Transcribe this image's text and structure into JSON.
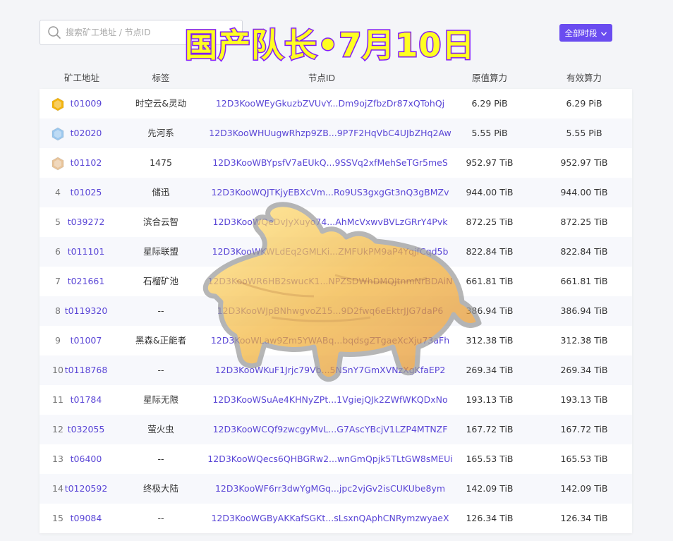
{
  "search": {
    "placeholder": "搜索矿工地址 / 节点ID"
  },
  "banner": {
    "text": "国产队长•7月10日"
  },
  "period_select": {
    "label": "全部时段"
  },
  "columns": {
    "miner": "矿工地址",
    "tag": "标签",
    "node": "节点ID",
    "raw_power": "原值算力",
    "effective_power": "有效算力"
  },
  "rows": [
    {
      "rank": "",
      "medal": "gold-medal-icon",
      "miner": "t01009",
      "tag": "时空云&灵动",
      "node": "12D3KooWEyGkuzbZVUvY...Dm9ojZfbzDr87xQTohQj",
      "raw": "6.29 PiB",
      "eff": "6.29 PiB"
    },
    {
      "rank": "",
      "medal": "silver-medal-icon",
      "miner": "t02020",
      "tag": "先河系",
      "node": "12D3KooWHUugwRhzp9ZB...9P7F2HqVbC4UJbZHq2Aw",
      "raw": "5.55 PiB",
      "eff": "5.55 PiB"
    },
    {
      "rank": "",
      "medal": "bronze-medal-icon",
      "miner": "t01102",
      "tag": "1475",
      "node": "12D3KooWBYpsfV7aEUkQ...9SSVq2xfMehSeTGr5meS",
      "raw": "952.97 TiB",
      "eff": "952.97 TiB"
    },
    {
      "rank": "4",
      "medal": "",
      "miner": "t01025",
      "tag": "储迅",
      "node": "12D3KooWQJTKjyEBXcVm...Ro9US3gxgGt3nQ3gBMZv",
      "raw": "944.00 TiB",
      "eff": "944.00 TiB"
    },
    {
      "rank": "5",
      "medal": "",
      "miner": "t039272",
      "tag": "滨合云智",
      "node": "12D3KooWQeDvJyXuyo74...AhMcVxwvBVLzGRrY4Pvk",
      "raw": "872.25 TiB",
      "eff": "872.25 TiB"
    },
    {
      "rank": "6",
      "medal": "",
      "miner": "t011101",
      "tag": "星际联盟",
      "node": "12D3KooWKWLdEq2GMLKi...ZMFUkPM9aP4YqjfCqd5b",
      "raw": "822.84 TiB",
      "eff": "822.84 TiB"
    },
    {
      "rank": "7",
      "medal": "",
      "miner": "t021661",
      "tag": "石榴矿池",
      "node": "12D3KooWR6HB2swucK1...NPZSDWhDMQJtnmNrBDAiN",
      "raw": "661.81 TiB",
      "eff": "661.81 TiB"
    },
    {
      "rank": "8",
      "medal": "",
      "miner": "t0119320",
      "tag": "--",
      "node": "12D3KooWJpBNhwgvoZ15...9D2fwq6eEktrJJG7daP6",
      "raw": "386.94 TiB",
      "eff": "386.94 TiB"
    },
    {
      "rank": "9",
      "medal": "",
      "miner": "t01007",
      "tag": "黑森&正能者",
      "node": "12D3KooWLaw9Zm5YWABq...bqdsgZTgaeXcXju73aFh",
      "raw": "312.38 TiB",
      "eff": "312.38 TiB"
    },
    {
      "rank": "10",
      "medal": "",
      "miner": "t0118768",
      "tag": "--",
      "node": "12D3KooWKuF1Jrjc79Vb...5NSnY7GmXVNzXgKfaEP2",
      "raw": "269.34 TiB",
      "eff": "269.34 TiB"
    },
    {
      "rank": "11",
      "medal": "",
      "miner": "t01784",
      "tag": "星际无限",
      "node": "12D3KooWSuAe4KHNyZPt...1VgiejQJk2ZWfWKQDxNo",
      "raw": "193.13 TiB",
      "eff": "193.13 TiB"
    },
    {
      "rank": "12",
      "medal": "",
      "miner": "t032055",
      "tag": "萤火虫",
      "node": "12D3KooWCQf9zwcgyMvL...G7AscYBcjV1LZP4MTNZF",
      "raw": "167.72 TiB",
      "eff": "167.72 TiB"
    },
    {
      "rank": "13",
      "medal": "",
      "miner": "t06400",
      "tag": "--",
      "node": "12D3KooWQecs6QHBGRw2...wnGmQpjk5TLtGW8sMEUi",
      "raw": "165.53 TiB",
      "eff": "165.53 TiB"
    },
    {
      "rank": "14",
      "medal": "",
      "miner": "t0120592",
      "tag": "终极大陆",
      "node": "12D3KooWF6rr3dwYgMGq...jpc2vjGv2isCUKUbe8ym",
      "raw": "142.09 TiB",
      "eff": "142.09 TiB"
    },
    {
      "rank": "15",
      "medal": "",
      "miner": "t09084",
      "tag": "--",
      "node": "12D3KooWGByAKKafSGKt...sLsxnQAphCNRymzwyaeX",
      "raw": "126.34 TiB",
      "eff": "126.34 TiB"
    }
  ],
  "colors": {
    "accent": "#6a4cf0",
    "link": "#5a46d6",
    "banner_fill": "#ffff22",
    "banner_stroke": "#8a22ff",
    "gold": "#f3b40f",
    "silver": "#9cc8ee",
    "bronze": "#e8c49a"
  },
  "watermark_icon": "bull-icon"
}
